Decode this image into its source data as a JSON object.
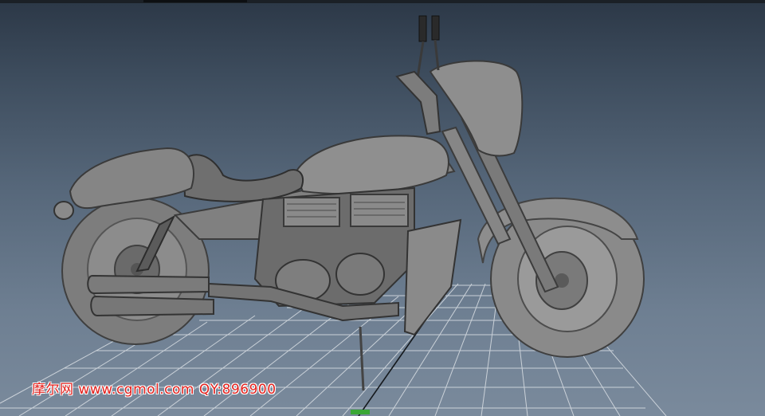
{
  "viewport": {
    "name": "3D modeling viewport",
    "colors": {
      "background_top": "#2c3847",
      "background_bottom": "#7a8a9c",
      "grid_line": "#cfd6dd",
      "grid_center": "#1a1e22",
      "model_light": "#9a9a9a",
      "model_mid": "#7b7b7b",
      "model_dark": "#4f4f4f",
      "watermark": "#e3201c",
      "axis_green": "#3aa635"
    }
  },
  "model": {
    "subject": "motorcycle",
    "icon": "motorcycle-model"
  },
  "watermark": {
    "text": "摩尔网 www.cgmol.com QY:896900"
  }
}
